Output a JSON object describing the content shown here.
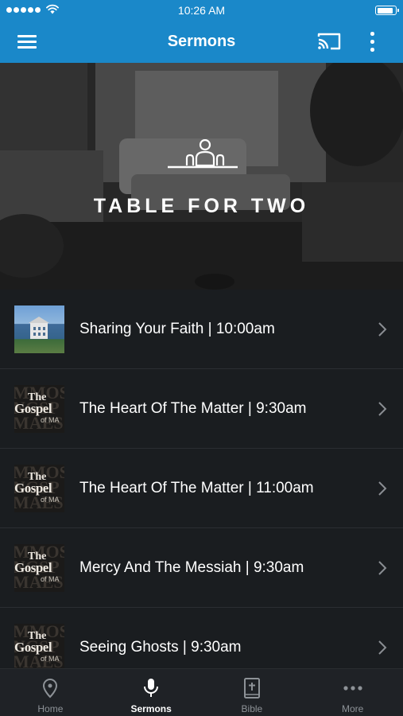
{
  "status_bar": {
    "time": "10:26 AM"
  },
  "app_bar": {
    "title": "Sermons"
  },
  "hero": {
    "title": "TABLE FOR TWO"
  },
  "sermons": [
    {
      "title": "Sharing Your Faith | 10:00am",
      "thumbnail": "church-building"
    },
    {
      "title": "The Heart Of The Matter | 9:30am",
      "thumbnail": "gospel-of-mark"
    },
    {
      "title": "The Heart Of The Matter | 11:00am",
      "thumbnail": "gospel-of-mark"
    },
    {
      "title": "Mercy And The Messiah | 9:30am",
      "thumbnail": "gospel-of-mark"
    },
    {
      "title": "Seeing Ghosts | 9:30am",
      "thumbnail": "gospel-of-mark"
    }
  ],
  "thumbnail_text": {
    "the": "The",
    "gospel": "Gospel",
    "of_mark": "of MA"
  },
  "tabs": [
    {
      "label": "Home",
      "icon": "location-pin-icon",
      "active": false
    },
    {
      "label": "Sermons",
      "icon": "microphone-icon",
      "active": true
    },
    {
      "label": "Bible",
      "icon": "bible-icon",
      "active": false
    },
    {
      "label": "More",
      "icon": "more-dots-icon",
      "active": false
    }
  ],
  "colors": {
    "accent": "#1a88c9",
    "background": "#1a1d20",
    "tab_inactive": "#8d9297"
  }
}
